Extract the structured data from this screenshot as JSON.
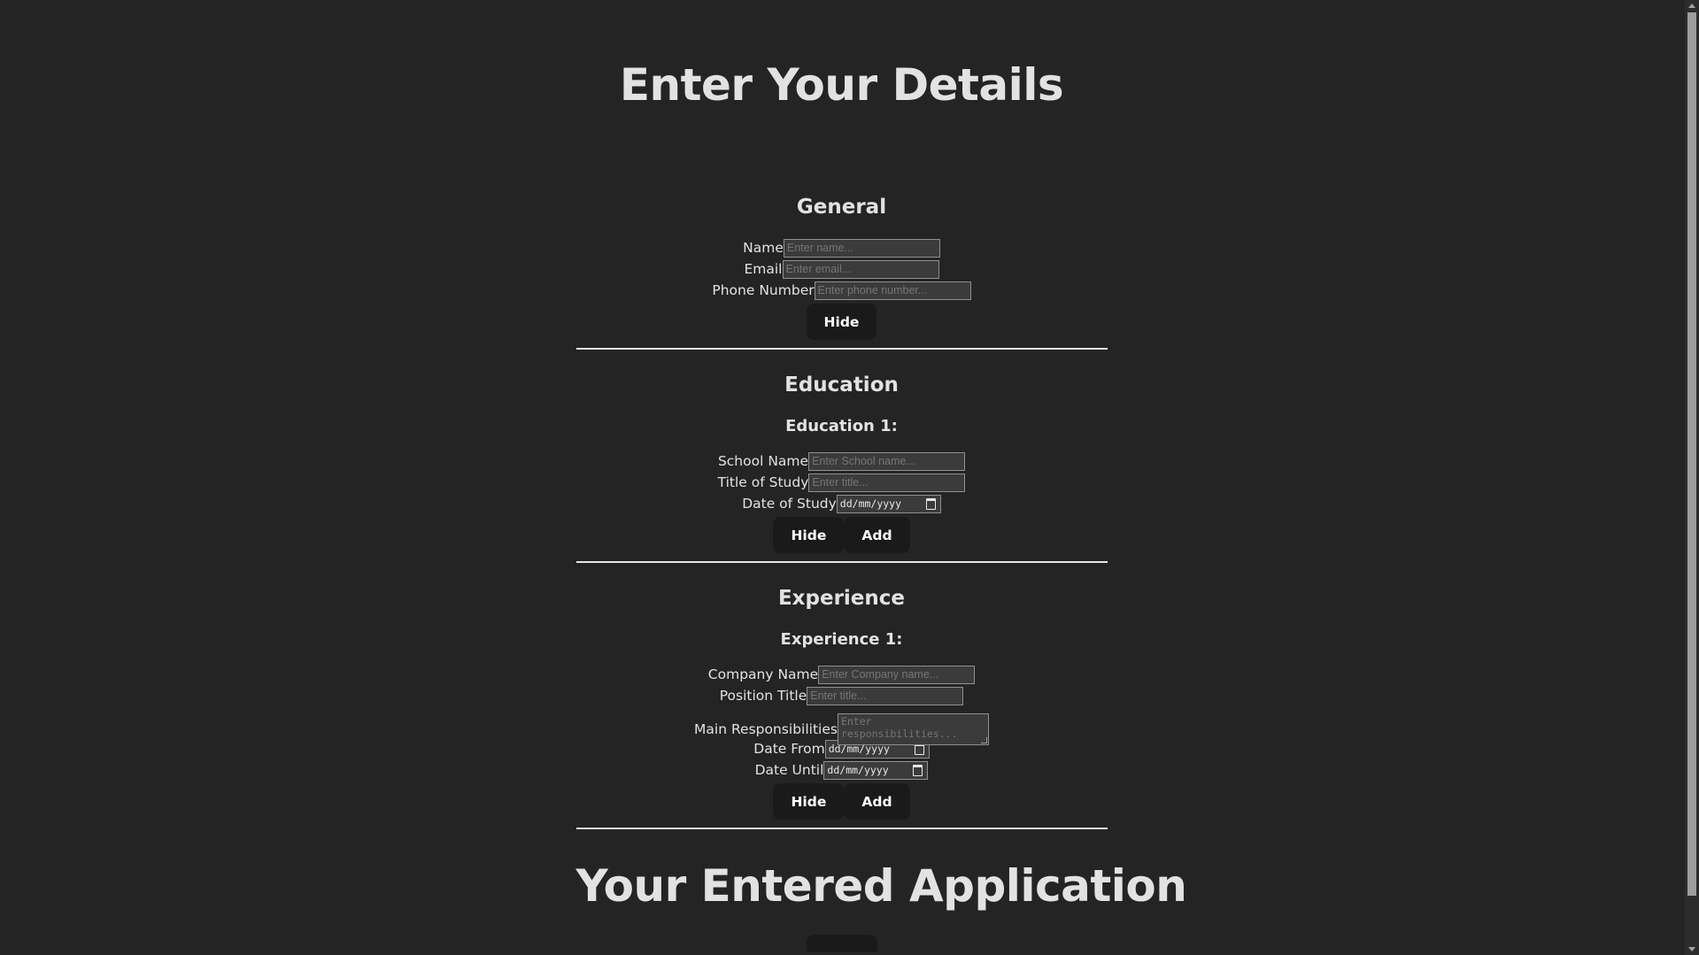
{
  "page": {
    "title": "Enter Your Details",
    "bottom_title": "Your Entered Application"
  },
  "general": {
    "heading": "General",
    "fields": {
      "name": {
        "label": "Name",
        "placeholder": "Enter name..."
      },
      "email": {
        "label": "Email",
        "placeholder": "Enter email..."
      },
      "phone": {
        "label": "Phone Number",
        "placeholder": "Enter phone number..."
      }
    },
    "hide_label": "Hide"
  },
  "education": {
    "heading": "Education",
    "entry_heading": "Education 1:",
    "fields": {
      "school": {
        "label": "School Name",
        "placeholder": "Enter School name..."
      },
      "title": {
        "label": "Title of Study",
        "placeholder": "Enter title..."
      },
      "date": {
        "label": "Date of Study",
        "value": "dd/mm/yyyy"
      }
    },
    "hide_label": "Hide",
    "add_label": "Add"
  },
  "experience": {
    "heading": "Experience",
    "entry_heading": "Experience 1:",
    "fields": {
      "company": {
        "label": "Company Name",
        "placeholder": "Enter Company name..."
      },
      "position": {
        "label": "Position Title",
        "placeholder": "Enter title..."
      },
      "responsibilities": {
        "label": "Main Responsibilities",
        "placeholder": "Enter responsibilities..."
      },
      "date_from": {
        "label": "Date From",
        "value": "dd/mm/yyyy"
      },
      "date_until": {
        "label": "Date Until",
        "value": "dd/mm/yyyy"
      }
    },
    "hide_label": "Hide",
    "add_label": "Add"
  },
  "icons": {
    "calendar": "calendar-icon"
  },
  "colors": {
    "background": "#242424",
    "button": "#1a1a1a",
    "divider": "#e8e8e8"
  }
}
